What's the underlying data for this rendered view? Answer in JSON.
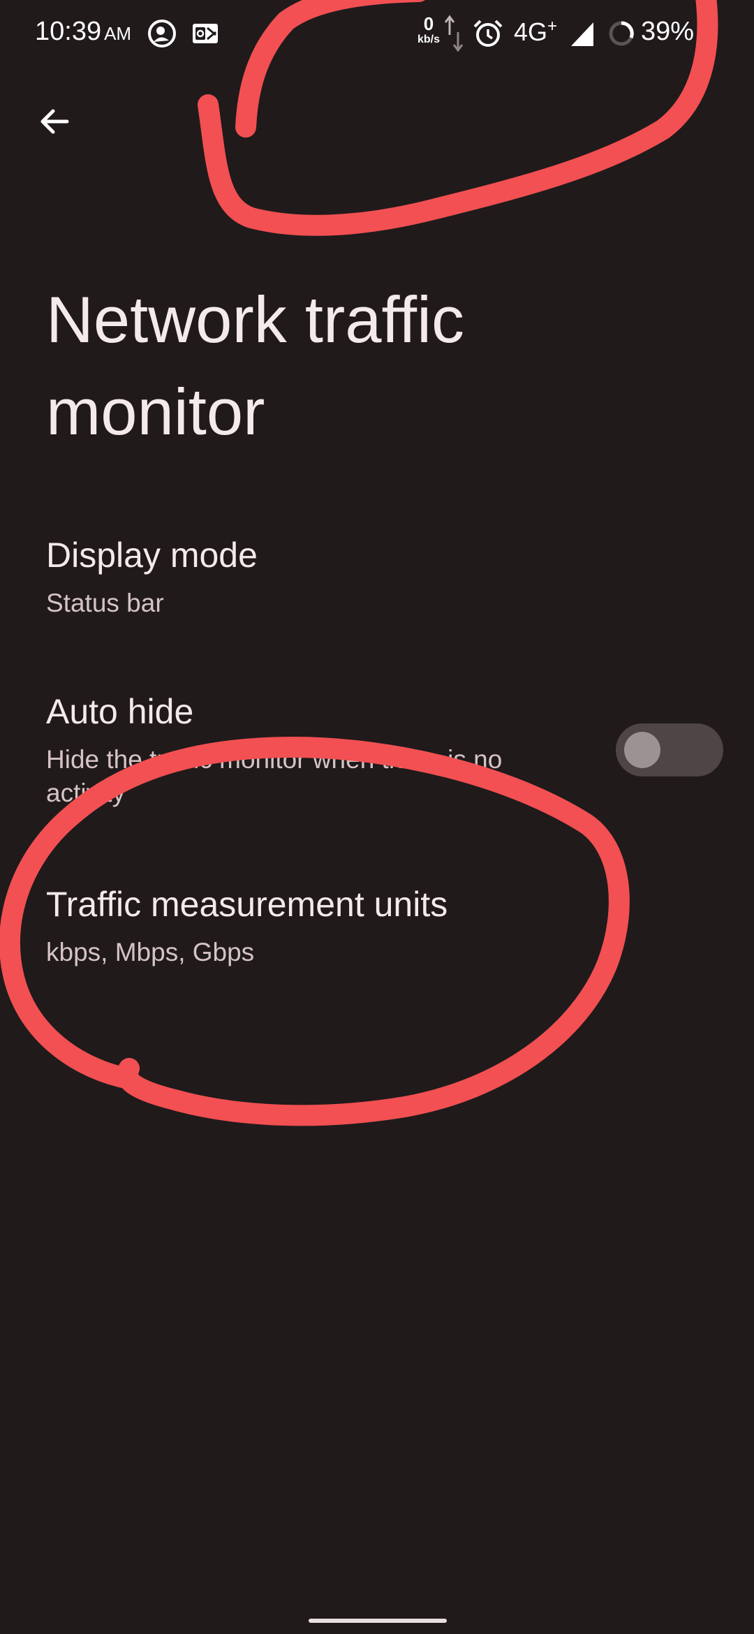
{
  "status_bar": {
    "time": "10:39",
    "ampm": "AM",
    "speed_value": "0",
    "speed_unit": "kb/s",
    "network_label": "4G",
    "network_sup": "+",
    "battery_text": "39%",
    "icons": [
      "whatsapp-icon",
      "outlook-icon",
      "data-arrows-icon",
      "alarm-icon",
      "signal-icon",
      "battery-ring-icon"
    ]
  },
  "toolbar": {
    "back_icon": "arrow-back-icon"
  },
  "page": {
    "title": "Network traffic monitor"
  },
  "preferences": {
    "display_mode": {
      "title": "Display mode",
      "summary": "Status bar"
    },
    "auto_hide": {
      "title": "Auto hide",
      "summary": "Hide the traffic monitor when there is no activity",
      "enabled": false
    },
    "units": {
      "title": "Traffic measurement units",
      "summary": "kbps, Mbps, Gbps"
    }
  },
  "colors": {
    "background": "#201a1b",
    "annotation": "#f25052",
    "text_primary": "#f5eaeb",
    "text_secondary": "#d6c3c5"
  }
}
